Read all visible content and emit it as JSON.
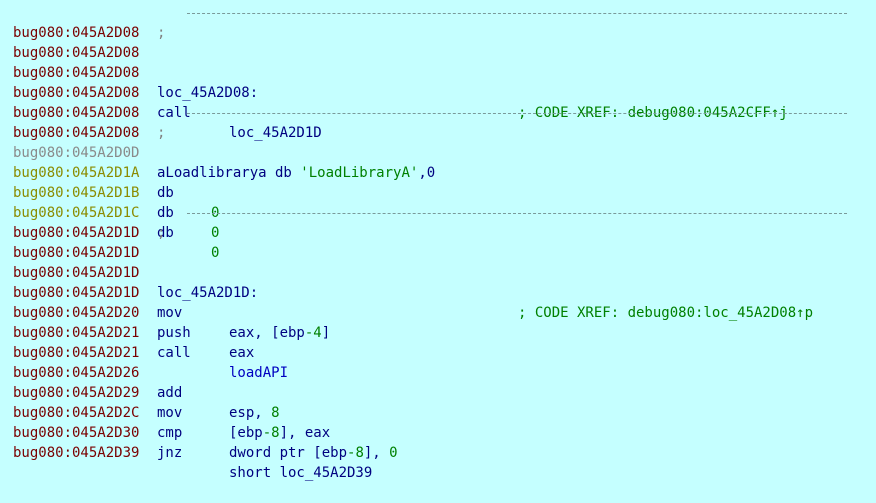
{
  "rows": [
    {
      "addr": "bug080:045A2D08",
      "sep": ";"
    },
    {
      "addr": "bug080:045A2D08"
    },
    {
      "addr": "bug080:045A2D08",
      "label": "loc_45A2D08:",
      "xref": "; CODE XREF: debug080:045A2CFF↑j"
    },
    {
      "addr": "bug080:045A2D08",
      "mnem": "call",
      "operand": "loc_45A2D1D"
    },
    {
      "addr": "bug080:045A2D08"
    },
    {
      "addr": "bug080:045A2D08",
      "sep": ";"
    },
    {
      "addr": "bug080:045A2D0D",
      "string_name": "aLoadlibrarya db ",
      "string_lit": "'LoadLibraryA'",
      "string_tail": ",0"
    },
    {
      "addr": "bug080:045A2D1A",
      "mnem": "db",
      "value": "0"
    },
    {
      "addr": "bug080:045A2D1B",
      "mnem": "db",
      "value": "0"
    },
    {
      "addr": "bug080:045A2D1C",
      "mnem": "db",
      "value": "0"
    },
    {
      "addr": "bug080:045A2D1D",
      "sep": ";"
    },
    {
      "addr": "bug080:045A2D1D"
    },
    {
      "addr": "bug080:045A2D1D",
      "label": "loc_45A2D1D:",
      "xref": "; CODE XREF: debug080:loc_45A2D08↑p"
    },
    {
      "addr": "bug080:045A2D1D",
      "mnem": "mov",
      "operand_pre": "eax, [ebp",
      "operand_num": "-4",
      "operand_post": "]"
    },
    {
      "addr": "bug080:045A2D20",
      "mnem": "push",
      "operand": "eax"
    },
    {
      "addr": "bug080:045A2D21",
      "mnem": "call",
      "operand_fn": "loadAPI"
    },
    {
      "addr": "bug080:045A2D21"
    },
    {
      "addr": "bug080:045A2D26",
      "mnem": "add",
      "operand_pre": "esp, ",
      "operand_num": "8",
      "operand_post": ""
    },
    {
      "addr": "bug080:045A2D29",
      "mnem": "mov",
      "operand_pre": "[ebp",
      "operand_num": "-8",
      "operand_post": "], eax"
    },
    {
      "addr": "bug080:045A2D2C",
      "mnem": "cmp",
      "operand_pre": "dword ptr [ebp",
      "operand_num": "-8",
      "operand_post": "], ",
      "operand_num2": "0"
    },
    {
      "addr": "bug080:045A2D30",
      "mnem": "jnz",
      "operand": "short loc_45A2D39"
    },
    {
      "addr": "bug080:045A2D39"
    }
  ]
}
